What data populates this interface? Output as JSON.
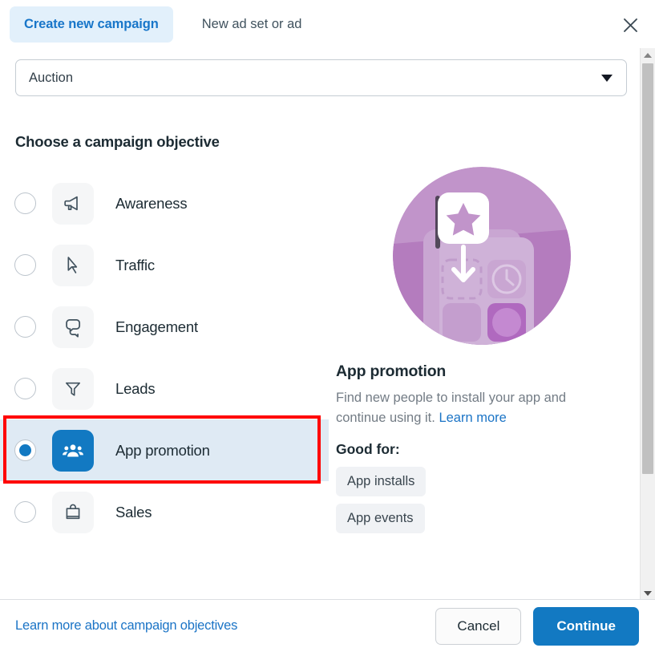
{
  "header": {
    "tab_active": "Create new campaign",
    "tab_inactive": "New ad set or ad",
    "close_icon": "close-icon"
  },
  "buying_type": {
    "value": "Auction",
    "caret_icon": "chevron-down-icon"
  },
  "objective_section": {
    "title": "Choose a campaign objective",
    "options": [
      {
        "label": "Awareness",
        "icon": "megaphone-icon",
        "selected": false
      },
      {
        "label": "Traffic",
        "icon": "cursor-icon",
        "selected": false
      },
      {
        "label": "Engagement",
        "icon": "chat-bubbles-icon",
        "selected": false
      },
      {
        "label": "Leads",
        "icon": "funnel-icon",
        "selected": false
      },
      {
        "label": "App promotion",
        "icon": "people-icon",
        "selected": true
      },
      {
        "label": "Sales",
        "icon": "shopping-bag-icon",
        "selected": false
      }
    ]
  },
  "detail": {
    "illustration": "app-promotion-illustration",
    "title": "App promotion",
    "description": "Find new people to install your app and continue using it.",
    "learn_more": "Learn more",
    "good_for_label": "Good for:",
    "chips": [
      "App installs",
      "App events"
    ]
  },
  "footer": {
    "link": "Learn more about campaign objectives",
    "cancel": "Cancel",
    "continue": "Continue"
  },
  "colors": {
    "accent_blue": "#1279c2",
    "tab_blue": "#1876c9",
    "tab_bg": "#e2f0fb",
    "selected_row_bg": "#dfeaf4",
    "highlight_red": "#ff0000",
    "chip_bg": "#f0f2f5",
    "tile_bg": "#f5f6f7",
    "muted_text": "#737c85"
  },
  "scrollbar": {
    "up_icon": "scroll-up-arrow-icon",
    "down_icon": "scroll-down-arrow-icon"
  }
}
